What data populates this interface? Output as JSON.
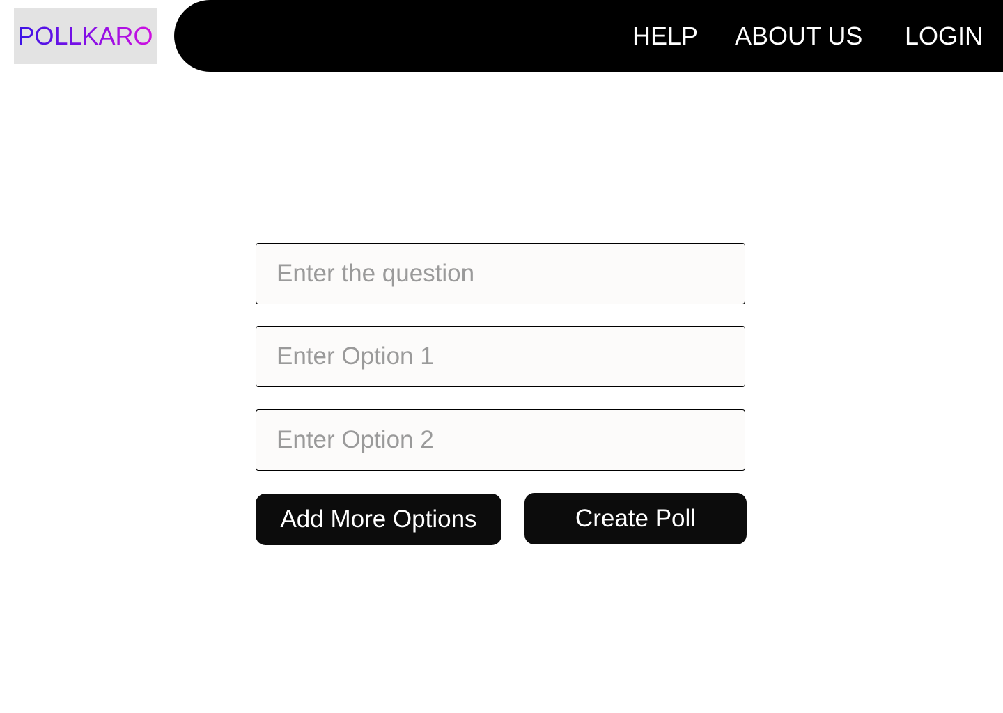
{
  "brand": {
    "logo_text": "POLLKARO",
    "gradient_start": "#3b13e6",
    "gradient_end": "#d010e0",
    "logo_background": "#e3e3e3"
  },
  "nav": {
    "background": "#000000",
    "items": [
      {
        "label": "HELP"
      },
      {
        "label": "ABOUT US"
      },
      {
        "label": "LOGIN"
      }
    ]
  },
  "form": {
    "question_placeholder": "Enter the question",
    "question_value": "",
    "options": [
      {
        "placeholder": "Enter Option 1",
        "value": ""
      },
      {
        "placeholder": "Enter Option 2",
        "value": ""
      }
    ],
    "add_more_label": "Add More Options",
    "create_label": "Create Poll"
  }
}
